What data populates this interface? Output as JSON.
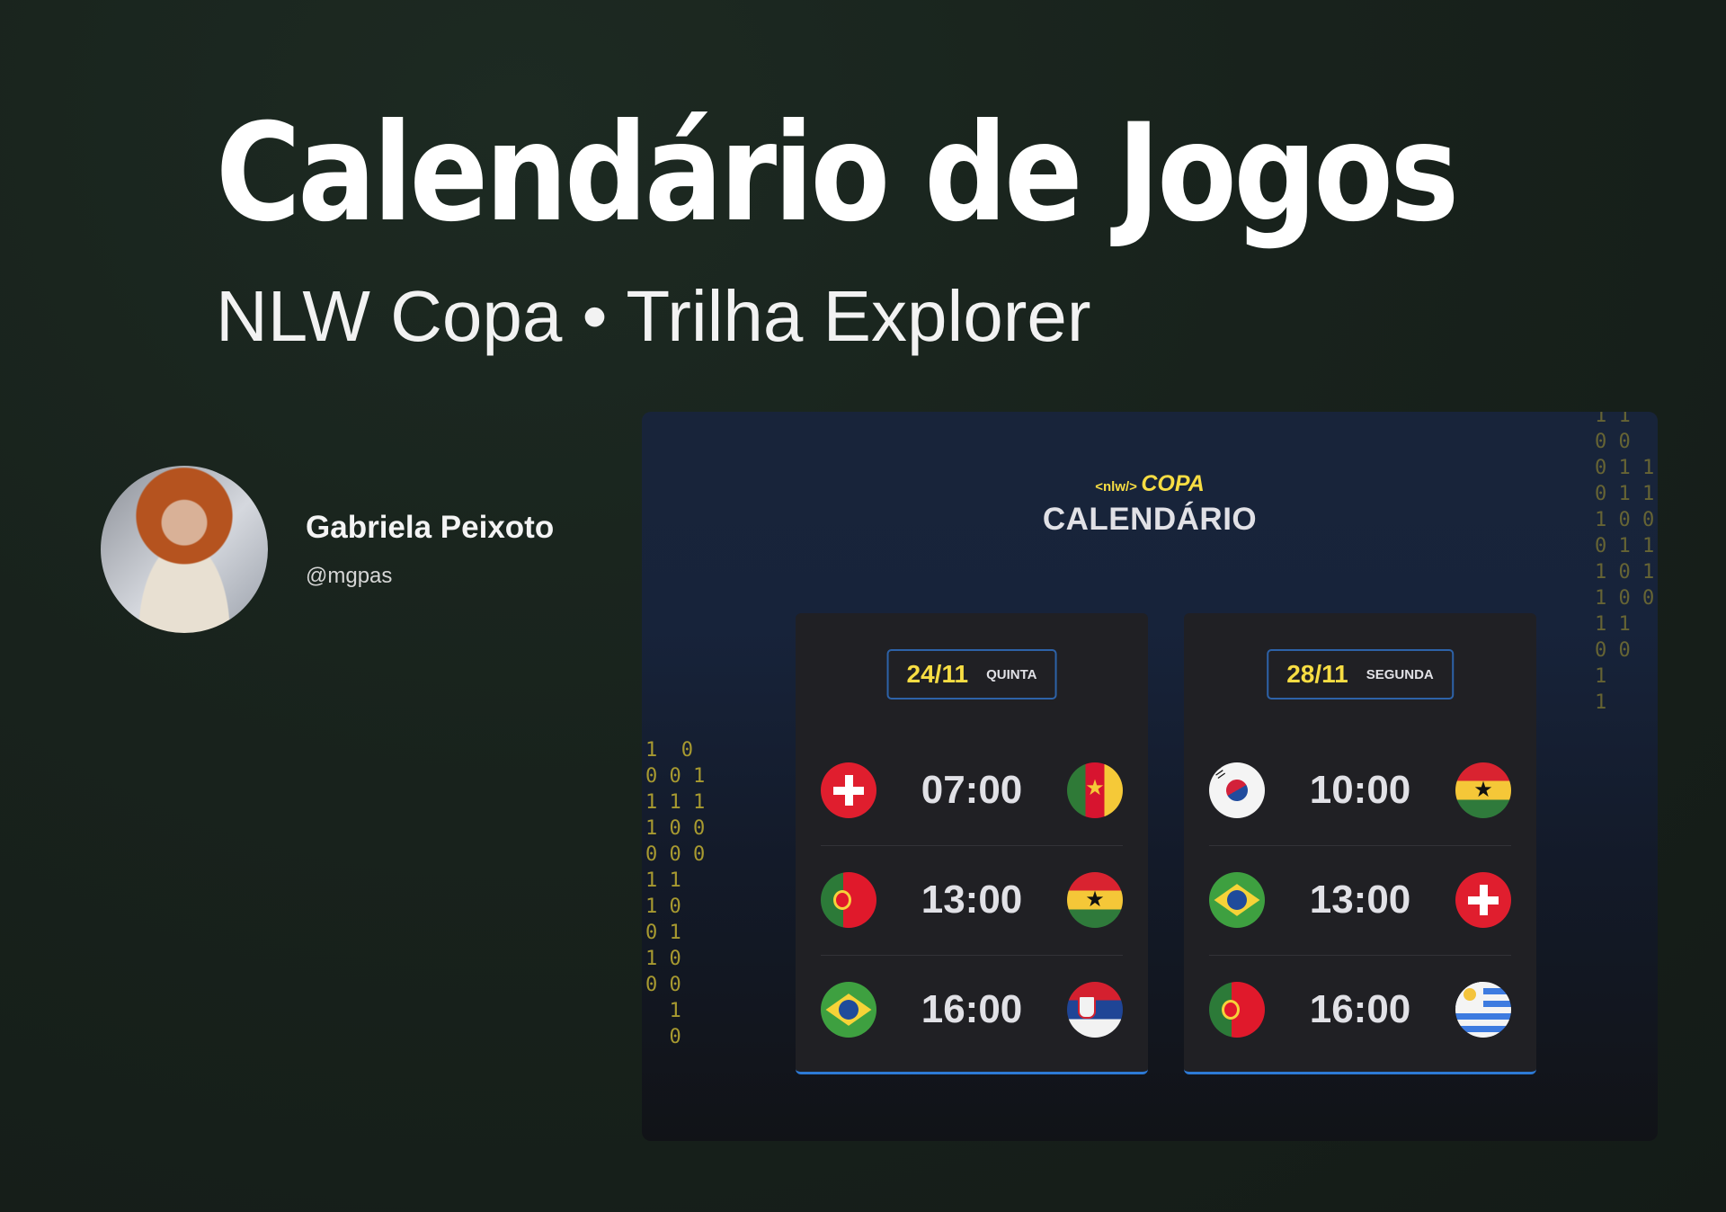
{
  "header": {
    "title": "Calendário de Jogos",
    "subtitle": "NLW Copa • Trilha Explorer"
  },
  "author": {
    "name": "Gabriela Peixoto",
    "handle": "@mgpas"
  },
  "screenshot": {
    "logo_tag": "<nlw/>",
    "logo_word": "COPA",
    "page_title": "CALENDÁRIO",
    "binary_left": "1  0\n0 0 1\n1 1 1\n1 0 0\n0 0 0\n1 1\n1 0\n0 1\n1 0\n0 0\n  1\n  0",
    "binary_right": "1 1\n0 0\n0 1 1\n0 1 1\n1 0 0\n0 1 1\n1 0 1\n1 0 0\n1 1\n0 0\n1\n1",
    "days": [
      {
        "date": "24/11",
        "weekday": "QUINTA",
        "games": [
          {
            "time": "07:00",
            "home_flag": "switzerland-flag-icon",
            "away_flag": "cameroon-flag-icon"
          },
          {
            "time": "13:00",
            "home_flag": "portugal-flag-icon",
            "away_flag": "ghana-flag-icon"
          },
          {
            "time": "16:00",
            "home_flag": "brazil-flag-icon",
            "away_flag": "serbia-flag-icon"
          }
        ]
      },
      {
        "date": "28/11",
        "weekday": "SEGUNDA",
        "games": [
          {
            "time": "10:00",
            "home_flag": "south-korea-flag-icon",
            "away_flag": "ghana-flag-icon"
          },
          {
            "time": "13:00",
            "home_flag": "brazil-flag-icon",
            "away_flag": "switzerland-flag-icon"
          },
          {
            "time": "16:00",
            "home_flag": "portugal-flag-icon",
            "away_flag": "uruguay-flag-icon"
          }
        ]
      }
    ]
  },
  "colors": {
    "background": "#18221c",
    "accent_yellow": "#f7dd43",
    "accent_blue": "#2d7ad6",
    "card": "#202024"
  }
}
